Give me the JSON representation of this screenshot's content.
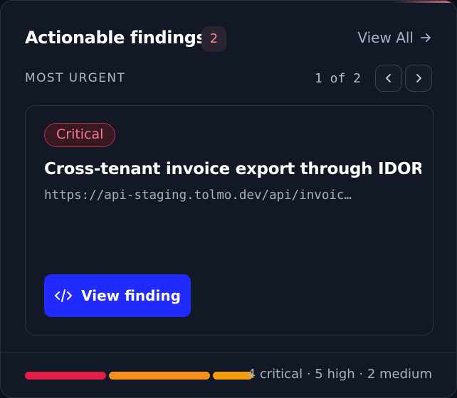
{
  "header": {
    "title": "Actionable findings",
    "count": "2",
    "view_all_label": "View All"
  },
  "subheader": {
    "section_label": "MOST URGENT",
    "pager_text": "1 of 2"
  },
  "finding": {
    "severity": "Critical",
    "title": "Cross-tenant invoice export through IDOR",
    "url": "https://api-staging.tolmo.dev/api/invoic…",
    "view_label": "View finding"
  },
  "footer": {
    "summary": "4 critical · 5 high · 2 medium",
    "severity_counts": {
      "critical": 4,
      "high": 5,
      "medium": 2
    }
  },
  "colors": {
    "accent": "#1f2bff",
    "critical": "#e11d48",
    "high": "#f7911b",
    "medium": "#f59e0b"
  },
  "icons": {
    "view_all": "arrow-right-icon",
    "prev": "chevron-left-icon",
    "next": "chevron-right-icon",
    "view_finding": "code-icon"
  }
}
